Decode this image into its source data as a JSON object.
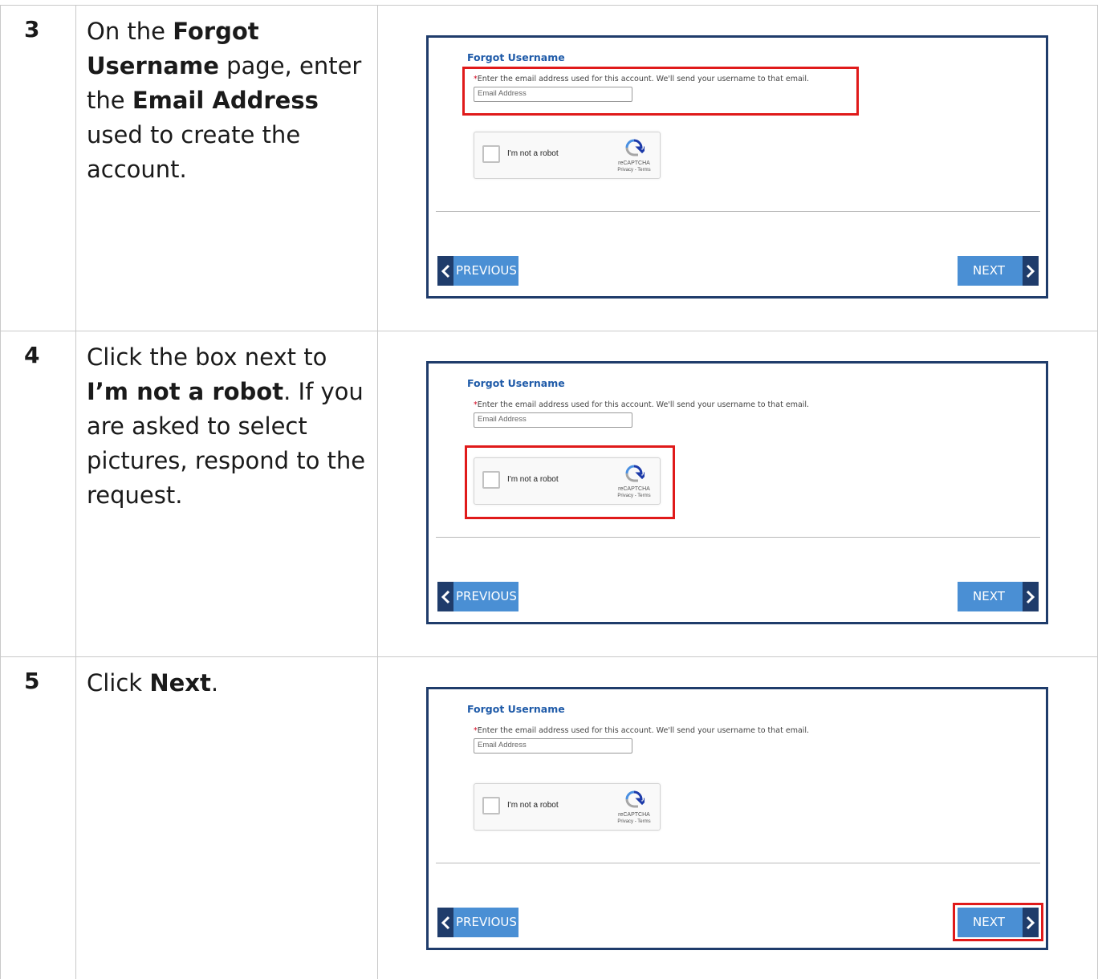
{
  "steps": [
    {
      "number": "3",
      "instruction_parts": [
        {
          "text": "On the ",
          "bold": false
        },
        {
          "text": "Forgot Username",
          "bold": true
        },
        {
          "text": " page, enter the ",
          "bold": false
        },
        {
          "text": "Email Address",
          "bold": true
        },
        {
          "text": " used to create the account.",
          "bold": false
        }
      ],
      "highlight": "email"
    },
    {
      "number": "4",
      "instruction_parts": [
        {
          "text": "Click the box next to ",
          "bold": false
        },
        {
          "text": "I’m not a robot",
          "bold": true
        },
        {
          "text": ". If you are asked to select pictures, respond to the request.",
          "bold": false
        }
      ],
      "highlight": "captcha"
    },
    {
      "number": "5",
      "instruction_parts": [
        {
          "text": "Click ",
          "bold": false
        },
        {
          "text": "Next",
          "bold": true
        },
        {
          "text": ".",
          "bold": false
        }
      ],
      "highlight": "next"
    }
  ],
  "form": {
    "title": "Forgot Username",
    "required_marker": "*",
    "description": "Enter the email address used for this account. We'll send your username to that email.",
    "email_placeholder": "Email Address",
    "captcha_label": "I'm not a robot",
    "captcha_brand": "reCAPTCHA",
    "captcha_terms": "Privacy - Terms",
    "previous_label": "PREVIOUS",
    "next_label": "NEXT"
  },
  "colors": {
    "highlight": "#e01a1a",
    "frame_border": "#1f3c6b",
    "button": "#4a8fd4",
    "title": "#1e5aa8"
  }
}
